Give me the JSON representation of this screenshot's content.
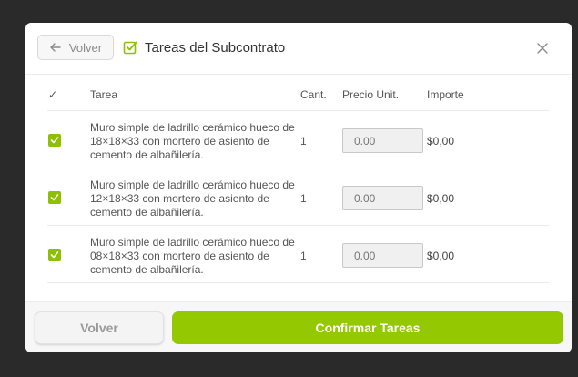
{
  "header": {
    "back_label": "Volver",
    "title": "Tareas del Subcontrato"
  },
  "table": {
    "columns": [
      "✓",
      "Tarea",
      "Cant.",
      "Precio Unit.",
      "Importe"
    ],
    "rows": [
      {
        "checked": true,
        "task": "Muro simple de ladrillo cerámico hueco de 18×18×33 con mortero de asiento de cemento de albañilería.",
        "qty": "1",
        "price_placeholder": "0.00",
        "amount": "$0,00"
      },
      {
        "checked": true,
        "task": "Muro simple de ladrillo cerámico hueco de 12×18×33 con mortero de asiento de cemento de albañilería.",
        "qty": "1",
        "price_placeholder": "0.00",
        "amount": "$0,00"
      },
      {
        "checked": true,
        "task": "Muro simple de ladrillo cerámico hueco de 08×18×33 con mortero de asiento de cemento de albañilería.",
        "qty": "1",
        "price_placeholder": "0.00",
        "amount": "$0,00"
      }
    ]
  },
  "footer": {
    "back_label": "Volver",
    "confirm_label": "Confirmar Tareas"
  },
  "colors": {
    "accent": "#94c800",
    "checkbox": "#8dc000"
  },
  "icons": {
    "back": "arrow-left-icon",
    "title": "checkbox-checked-icon",
    "close": "close-icon"
  }
}
